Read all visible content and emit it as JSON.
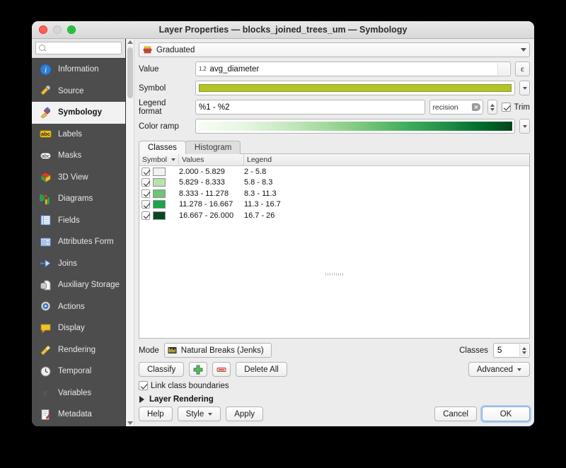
{
  "window": {
    "title": "Layer Properties — blocks_joined_trees_um — Symbology",
    "traffic": {
      "close": "close-button",
      "minimize": "minimize-button",
      "zoom": "zoom-button"
    }
  },
  "search": {
    "value": "",
    "placeholder": ""
  },
  "sidebar": {
    "items": [
      {
        "label": "Information",
        "icon": "information-icon",
        "active": false
      },
      {
        "label": "Source",
        "icon": "source-icon",
        "active": false
      },
      {
        "label": "Symbology",
        "icon": "symbology-icon",
        "active": true
      },
      {
        "label": "Labels",
        "icon": "labels-icon",
        "active": false
      },
      {
        "label": "Masks",
        "icon": "masks-icon",
        "active": false
      },
      {
        "label": "3D View",
        "icon": "3d-view-icon",
        "active": false
      },
      {
        "label": "Diagrams",
        "icon": "diagrams-icon",
        "active": false
      },
      {
        "label": "Fields",
        "icon": "fields-icon",
        "active": false
      },
      {
        "label": "Attributes Form",
        "icon": "attributes-form-icon",
        "active": false
      },
      {
        "label": "Joins",
        "icon": "joins-icon",
        "active": false
      },
      {
        "label": "Auxiliary Storage",
        "icon": "auxiliary-storage-icon",
        "active": false
      },
      {
        "label": "Actions",
        "icon": "actions-icon",
        "active": false
      },
      {
        "label": "Display",
        "icon": "display-icon",
        "active": false
      },
      {
        "label": "Rendering",
        "icon": "rendering-icon",
        "active": false
      },
      {
        "label": "Temporal",
        "icon": "temporal-icon",
        "active": false
      },
      {
        "label": "Variables",
        "icon": "variables-icon",
        "active": false
      },
      {
        "label": "Metadata",
        "icon": "metadata-icon",
        "active": false
      }
    ]
  },
  "renderer": {
    "label": "Graduated",
    "icon": "graduated-renderer-icon"
  },
  "form": {
    "value": {
      "label": "Value",
      "field_type_tag": "1.2",
      "value": "avg_diameter",
      "expression_button": "ε"
    },
    "symbol": {
      "label": "Symbol",
      "color": "#b5c425"
    },
    "legend_format": {
      "label": "Legend format",
      "value": "%1 - %2",
      "precision_value": "recision",
      "trim_label": "Trim",
      "trim_checked": true
    },
    "color_ramp": {
      "label": "Color ramp",
      "name": "Greens"
    }
  },
  "tabs": [
    {
      "label": "Classes",
      "active": true
    },
    {
      "label": "Histogram",
      "active": false
    }
  ],
  "table": {
    "headers": [
      "Symbol",
      "Values",
      "Legend"
    ],
    "rows": [
      {
        "checked": true,
        "color": "#f2f2f2",
        "values": "2.000 - 5.829",
        "legend": "2 - 5.8"
      },
      {
        "checked": true,
        "color": "#b6e3ad",
        "values": "5.829 - 8.333",
        "legend": "5.8 - 8.3"
      },
      {
        "checked": true,
        "color": "#6fc377",
        "values": "8.333 - 11.278",
        "legend": "8.3 - 11.3"
      },
      {
        "checked": true,
        "color": "#19a548",
        "values": "11.278 - 16.667",
        "legend": "11.3 - 16.7"
      },
      {
        "checked": true,
        "color": "#0a4720",
        "values": "16.667 - 26.000",
        "legend": "16.7 - 26"
      }
    ]
  },
  "controls": {
    "mode_label": "Mode",
    "mode_value": "Natural Breaks (Jenks)",
    "mode_icon": "natural-breaks-icon",
    "classes_label": "Classes",
    "classes_value": "5",
    "classify_button": "Classify",
    "add_class_button": "add-class-icon",
    "delete_class_button": "delete-class-icon",
    "delete_all_button": "Delete All",
    "advanced_button": "Advanced",
    "link_class_boundaries_label": "Link class boundaries",
    "link_class_boundaries_checked": true,
    "layer_rendering_label": "Layer Rendering"
  },
  "footer": {
    "help": "Help",
    "style": "Style",
    "apply": "Apply",
    "cancel": "Cancel",
    "ok": "OK"
  }
}
